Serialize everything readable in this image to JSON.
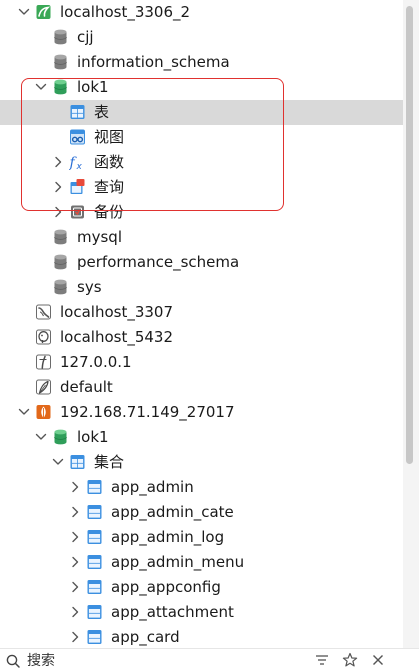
{
  "tree": [
    {
      "id": "conn-localhost-3306-2",
      "label": "localhost_3306_2",
      "depth": 0,
      "icon": "mysql-connection-icon",
      "expander": "expanded",
      "selected": false
    },
    {
      "id": "db-cjj",
      "label": "cjj",
      "depth": 1,
      "icon": "database-icon",
      "expander": "none",
      "selected": false
    },
    {
      "id": "db-information-schema",
      "label": "information_schema",
      "depth": 1,
      "icon": "database-icon",
      "expander": "none",
      "selected": false
    },
    {
      "id": "db-lok1",
      "label": "lok1",
      "depth": 1,
      "icon": "database-open-icon",
      "expander": "expanded",
      "selected": false
    },
    {
      "id": "folder-tables",
      "label": "表",
      "depth": 2,
      "icon": "table-icon",
      "expander": "none",
      "selected": true
    },
    {
      "id": "folder-views",
      "label": "视图",
      "depth": 2,
      "icon": "view-icon",
      "expander": "none",
      "selected": false
    },
    {
      "id": "folder-functions",
      "label": "函数",
      "depth": 2,
      "icon": "function-icon",
      "expander": "collapsed",
      "selected": false
    },
    {
      "id": "folder-queries",
      "label": "查询",
      "depth": 2,
      "icon": "query-icon",
      "expander": "collapsed",
      "selected": false
    },
    {
      "id": "folder-backups",
      "label": "备份",
      "depth": 2,
      "icon": "backup-icon",
      "expander": "collapsed",
      "selected": false
    },
    {
      "id": "db-mysql",
      "label": "mysql",
      "depth": 1,
      "icon": "database-icon",
      "expander": "none",
      "selected": false
    },
    {
      "id": "db-performance-schema",
      "label": "performance_schema",
      "depth": 1,
      "icon": "database-icon",
      "expander": "none",
      "selected": false
    },
    {
      "id": "db-sys",
      "label": "sys",
      "depth": 1,
      "icon": "database-icon",
      "expander": "none",
      "selected": false
    },
    {
      "id": "conn-localhost-3307",
      "label": "localhost_3307",
      "depth": 0,
      "icon": "mariadb-connection-icon",
      "expander": "none",
      "selected": false
    },
    {
      "id": "conn-localhost-5432",
      "label": "localhost_5432",
      "depth": 0,
      "icon": "postgresql-connection-icon",
      "expander": "none",
      "selected": false
    },
    {
      "id": "conn-127-0-0-1",
      "label": "127.0.0.1",
      "depth": 0,
      "icon": "sqlite-connection-icon",
      "expander": "none",
      "selected": false
    },
    {
      "id": "conn-default",
      "label": "default",
      "depth": 0,
      "icon": "feather-connection-icon",
      "expander": "none",
      "selected": false
    },
    {
      "id": "conn-mongo",
      "label": "192.168.71.149_27017",
      "depth": 0,
      "icon": "mongodb-connection-icon",
      "expander": "expanded",
      "selected": false
    },
    {
      "id": "mongo-db-lok1",
      "label": "lok1",
      "depth": 1,
      "icon": "database-open-icon",
      "expander": "expanded",
      "selected": false
    },
    {
      "id": "folder-collections",
      "label": "集合",
      "depth": 2,
      "icon": "table-icon",
      "expander": "expanded",
      "selected": false
    },
    {
      "id": "coll-app-admin",
      "label": "app_admin",
      "depth": 3,
      "icon": "collection-icon",
      "expander": "collapsed",
      "selected": false
    },
    {
      "id": "coll-app-admin-cate",
      "label": "app_admin_cate",
      "depth": 3,
      "icon": "collection-icon",
      "expander": "collapsed",
      "selected": false
    },
    {
      "id": "coll-app-admin-log",
      "label": "app_admin_log",
      "depth": 3,
      "icon": "collection-icon",
      "expander": "collapsed",
      "selected": false
    },
    {
      "id": "coll-app-admin-menu",
      "label": "app_admin_menu",
      "depth": 3,
      "icon": "collection-icon",
      "expander": "collapsed",
      "selected": false
    },
    {
      "id": "coll-app-appconfig",
      "label": "app_appconfig",
      "depth": 3,
      "icon": "collection-icon",
      "expander": "collapsed",
      "selected": false
    },
    {
      "id": "coll-app-attachment",
      "label": "app_attachment",
      "depth": 3,
      "icon": "collection-icon",
      "expander": "collapsed",
      "selected": false
    },
    {
      "id": "coll-app-card",
      "label": "app_card",
      "depth": 3,
      "icon": "collection-icon",
      "expander": "collapsed",
      "selected": false
    }
  ],
  "bottom_bar": {
    "search_label": "搜索",
    "icons": [
      "filter-icon",
      "star-icon",
      "close-icon"
    ]
  },
  "colors": {
    "selection_bg": "#d9d9d9",
    "highlight_border": "#e0322f",
    "db_gray": "#7d7d7d",
    "db_green": "#2f9e5a",
    "table_blue": "#3b8fe0"
  }
}
